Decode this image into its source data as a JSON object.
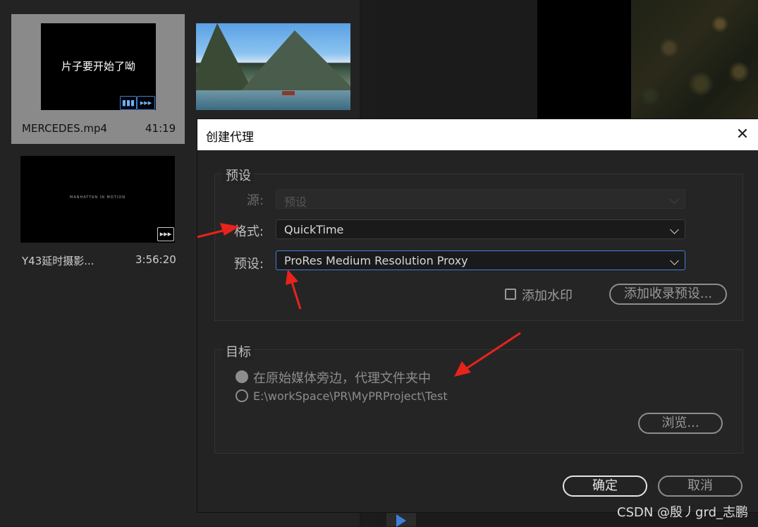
{
  "project_bin": {
    "clips": [
      {
        "thumb_text": "片子要开始了呦",
        "name": "MERCEDES.mp4",
        "duration": "41:19",
        "badges": [
          "video",
          "audio"
        ]
      },
      {
        "thumb_text": "",
        "name": "",
        "duration": "",
        "badges": []
      },
      {
        "thumb_text": "MANHATTAN IN MOTION",
        "name": "Y43延时摄影...",
        "duration": "3:56:20",
        "badges": [
          "audio"
        ]
      }
    ]
  },
  "dialog": {
    "title": "创建代理",
    "close_glyph": "✕",
    "preset_group": {
      "title": "预设",
      "source_label": "源:",
      "source_value": "预设",
      "format_label": "格式:",
      "format_value": "QuickTime",
      "preset_label": "预设:",
      "preset_value": "ProRes Medium Resolution Proxy",
      "watermark_label": "添加水印",
      "watermark_checked": false,
      "add_ingest_preset_button": "添加收录预设..."
    },
    "target_group": {
      "title": "目标",
      "option_next_to_media": "在原始媒体旁边，代理文件夹中",
      "option_custom_path": "E:\\workSpace\\PR\\MyPRProject\\Test",
      "selected": "next_to_media",
      "browse_button": "浏览..."
    },
    "ok_button": "确定",
    "cancel_button": "取消"
  },
  "watermark_text": "CSDN @殷丿grd_志鹏",
  "colors": {
    "accent": "#3d7fd9",
    "annotation_arrow": "#e8231c"
  },
  "icons": [
    "close-icon",
    "chevron-down-icon",
    "play-icon"
  ]
}
